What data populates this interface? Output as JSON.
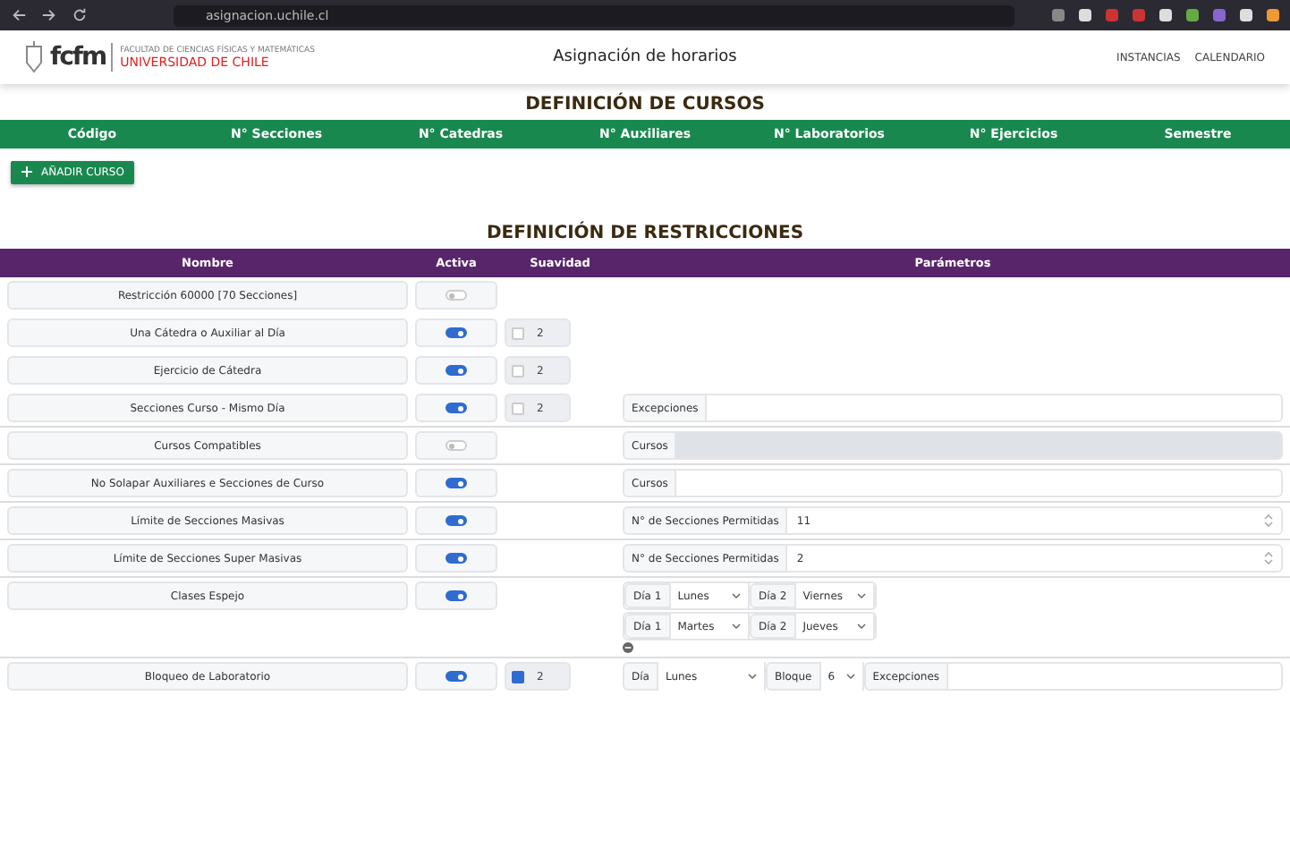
{
  "browser": {
    "url": "asignacion.uchile.cl"
  },
  "navbar": {
    "logo_mark": "fcfm",
    "logo_small": "FACULTAD DE CIENCIAS FÍSICAS Y MATEMÁTICAS",
    "logo_name": "UNIVERSIDAD DE CHILE",
    "title": "Asignación de horarios",
    "links": [
      "INSTANCIAS",
      "CALENDARIO"
    ]
  },
  "courses": {
    "title": "DEFINICIÓN DE CURSOS",
    "columns": [
      "Código",
      "N° Secciones",
      "N° Catedras",
      "N° Auxiliares",
      "N° Laboratorios",
      "N° Ejercicios",
      "Semestre"
    ],
    "add_button": "AÑADIR CURSO"
  },
  "restrictions": {
    "title": "DEFINICIÓN DE RESTRICCIONES",
    "columns": [
      "Nombre",
      "Activa",
      "Suavidad",
      "Parámetros"
    ],
    "rows": [
      {
        "name": "Restricción 60000 [70 Secciones]",
        "active": false,
        "kind": "none"
      },
      {
        "name": "Una Cátedra o Auxiliar al Día",
        "active": true,
        "softness": {
          "checked": false,
          "value": "2"
        },
        "kind": "none"
      },
      {
        "name": "Ejercicio de Cátedra",
        "active": true,
        "softness": {
          "checked": false,
          "value": "2"
        },
        "kind": "none"
      },
      {
        "name": "Secciones Curso - Mismo Día",
        "active": true,
        "softness": {
          "checked": false,
          "value": "2"
        },
        "kind": "text",
        "label": "Excepciones",
        "disabled": false
      },
      {
        "name": "Cursos Compatibles",
        "active": false,
        "kind": "text",
        "label": "Cursos",
        "disabled": true
      },
      {
        "name": "No Solapar Auxiliares e Secciones de Curso",
        "active": true,
        "kind": "text",
        "label": "Cursos",
        "disabled": false
      },
      {
        "name": "Límite de Secciones Masivas",
        "active": true,
        "kind": "number",
        "label": "N° de Secciones Permitidas",
        "value": "11"
      },
      {
        "name": "Límite de Secciones Super Masivas",
        "active": true,
        "kind": "number",
        "label": "N° de Secciones Permitidas",
        "value": "2"
      },
      {
        "name": "Clases Espejo",
        "active": true,
        "kind": "pairs",
        "pairs": [
          {
            "label_1": "Día 1",
            "day_1": "Lunes",
            "label_2": "Día 2",
            "day_2": "Viernes"
          },
          {
            "label_1": "Día 1",
            "day_1": "Martes",
            "label_2": "Día 2",
            "day_2": "Jueves"
          }
        ]
      },
      {
        "name": "Bloqueo de Laboratorio",
        "active": true,
        "softness": {
          "checked": true,
          "value": "2"
        },
        "kind": "block",
        "day_label": "Día",
        "day": "Lunes",
        "block_label": "Bloque",
        "block": "6",
        "extra_label": "Excepciones"
      }
    ]
  }
}
